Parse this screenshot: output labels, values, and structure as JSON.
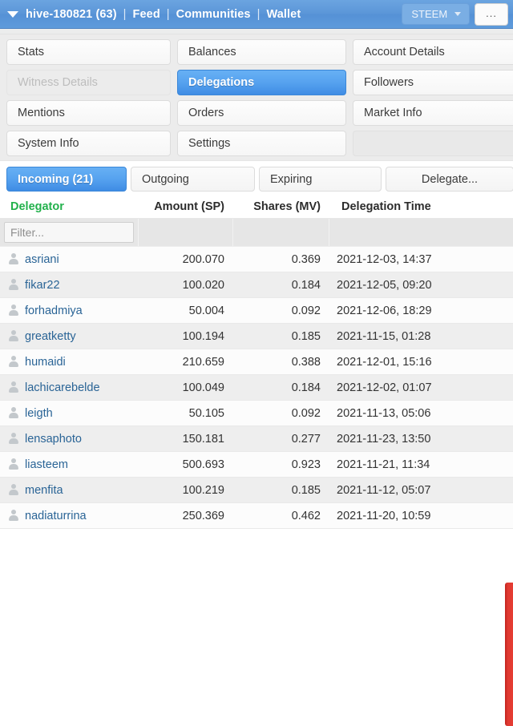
{
  "topbar": {
    "caret_icon": "chevron-down-icon",
    "account": "hive-180821 (63)",
    "sep": "|",
    "links": [
      "Feed",
      "Communities",
      "Wallet"
    ],
    "chain_selected": "STEEM",
    "chain_caret_icon": "chevron-down-icon",
    "more_label": "...",
    "bg_color": "#5b96d8"
  },
  "nav_grid": {
    "buttons": [
      {
        "label": "Stats",
        "state": "normal"
      },
      {
        "label": "Balances",
        "state": "normal"
      },
      {
        "label": "Account Details",
        "state": "normal"
      },
      {
        "label": "Witness Details",
        "state": "disabled"
      },
      {
        "label": "Delegations",
        "state": "active"
      },
      {
        "label": "Followers",
        "state": "normal"
      },
      {
        "label": "Mentions",
        "state": "normal"
      },
      {
        "label": "Orders",
        "state": "normal"
      },
      {
        "label": "Market Info",
        "state": "normal"
      },
      {
        "label": "System Info",
        "state": "normal"
      },
      {
        "label": "Settings",
        "state": "normal"
      },
      {
        "label": "",
        "state": "empty"
      }
    ],
    "active_color": "#4f9cec"
  },
  "tabs": [
    {
      "label": "Incoming (21)",
      "state": "active"
    },
    {
      "label": "Outgoing",
      "state": "normal"
    },
    {
      "label": "Expiring",
      "state": "normal"
    },
    {
      "label": "Delegate...",
      "state": "normal"
    }
  ],
  "table": {
    "headers": {
      "delegator": "Delegator",
      "amount": "Amount (SP)",
      "shares": "Shares (MV)",
      "time": "Delegation Time"
    },
    "header_delegator_color": "#22b14c",
    "filter": {
      "placeholder": "Filter...",
      "value": ""
    },
    "rows": [
      {
        "delegator": "asriani",
        "amount": "200.070",
        "shares": "0.369",
        "time": "2021-12-03, 14:37"
      },
      {
        "delegator": "fikar22",
        "amount": "100.020",
        "shares": "0.184",
        "time": "2021-12-05, 09:20"
      },
      {
        "delegator": "forhadmiya",
        "amount": "50.004",
        "shares": "0.092",
        "time": "2021-12-06, 18:29"
      },
      {
        "delegator": "greatketty",
        "amount": "100.194",
        "shares": "0.185",
        "time": "2021-11-15, 01:28"
      },
      {
        "delegator": "humaidi",
        "amount": "210.659",
        "shares": "0.388",
        "time": "2021-12-01, 15:16"
      },
      {
        "delegator": "lachicarebelde",
        "amount": "100.049",
        "shares": "0.184",
        "time": "2021-12-02, 01:07"
      },
      {
        "delegator": "leigth",
        "amount": "50.105",
        "shares": "0.092",
        "time": "2021-11-13, 05:06"
      },
      {
        "delegator": "lensaphoto",
        "amount": "150.181",
        "shares": "0.277",
        "time": "2021-11-23, 13:50"
      },
      {
        "delegator": "liasteem",
        "amount": "500.693",
        "shares": "0.923",
        "time": "2021-11-21, 11:34"
      },
      {
        "delegator": "menfita",
        "amount": "100.219",
        "shares": "0.185",
        "time": "2021-11-12, 05:07"
      },
      {
        "delegator": "nadiaturrina",
        "amount": "250.369",
        "shares": "0.462",
        "time": "2021-11-20, 10:59"
      }
    ]
  },
  "scroll_indicator": {
    "color": "#e03a32"
  }
}
